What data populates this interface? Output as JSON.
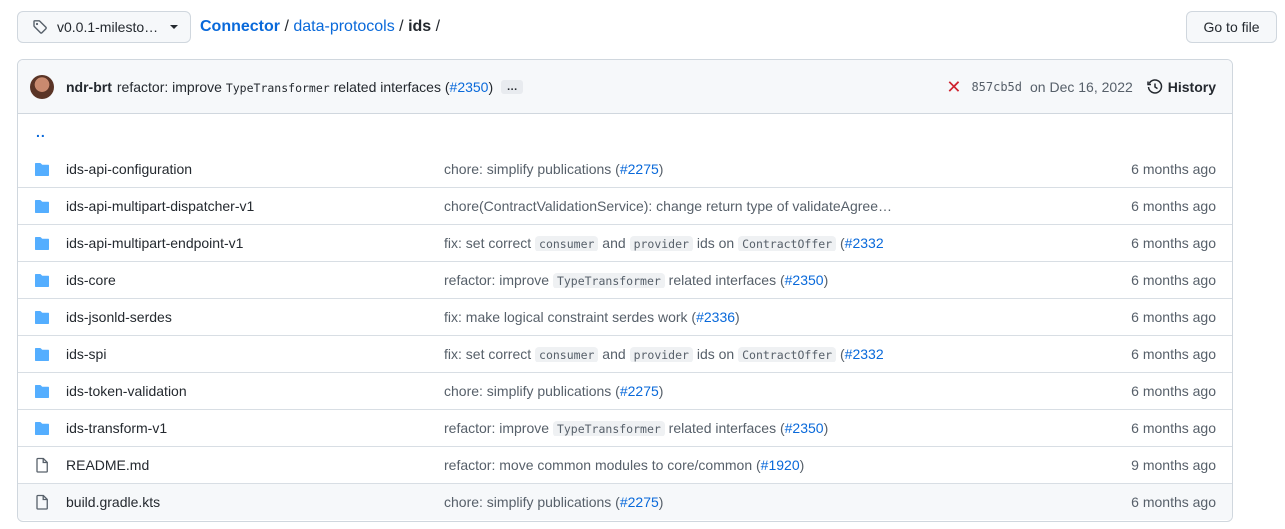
{
  "branch": {
    "label": "v0.0.1-milesto…",
    "icon": "tag-icon"
  },
  "breadcrumb": {
    "root": "Connector",
    "segment1": "data-protocols",
    "current": "ids",
    "sep": " / ",
    "trail": " /"
  },
  "go_to_file": "Go to file",
  "commit": {
    "author": "ndr-brt",
    "message_pre": "refactor: improve ",
    "message_code": "TypeTransformer",
    "message_post": " related interfaces (",
    "pr": "#2350",
    "message_end": ")",
    "more": "…",
    "status": "✕",
    "sha": "857cb5d",
    "date": "on Dec 16, 2022",
    "history": "History"
  },
  "parent_link": "..",
  "files": [
    {
      "type": "dir",
      "name": "ids-api-configuration",
      "age": "6 months ago",
      "msg": [
        {
          "t": "text",
          "v": "chore: simplify publications ("
        },
        {
          "t": "pr",
          "v": "#2275"
        },
        {
          "t": "text",
          "v": ")"
        }
      ]
    },
    {
      "type": "dir",
      "name": "ids-api-multipart-dispatcher-v1",
      "age": "6 months ago",
      "msg": [
        {
          "t": "text",
          "v": "chore(ContractValidationService): change return type of validateAgree…"
        }
      ]
    },
    {
      "type": "dir",
      "name": "ids-api-multipart-endpoint-v1",
      "age": "6 months ago",
      "msg": [
        {
          "t": "text",
          "v": "fix: set correct "
        },
        {
          "t": "code",
          "v": "consumer"
        },
        {
          "t": "text",
          "v": " and "
        },
        {
          "t": "code",
          "v": "provider"
        },
        {
          "t": "text",
          "v": " ids on "
        },
        {
          "t": "code",
          "v": "ContractOffer"
        },
        {
          "t": "text",
          "v": " ("
        },
        {
          "t": "pr",
          "v": "#2332"
        }
      ]
    },
    {
      "type": "dir",
      "name": "ids-core",
      "age": "6 months ago",
      "msg": [
        {
          "t": "text",
          "v": "refactor: improve "
        },
        {
          "t": "code",
          "v": "TypeTransformer"
        },
        {
          "t": "text",
          "v": " related interfaces ("
        },
        {
          "t": "pr",
          "v": "#2350"
        },
        {
          "t": "text",
          "v": ")"
        }
      ]
    },
    {
      "type": "dir",
      "name": "ids-jsonld-serdes",
      "age": "6 months ago",
      "msg": [
        {
          "t": "text",
          "v": "fix: make logical constraint serdes work ("
        },
        {
          "t": "pr",
          "v": "#2336"
        },
        {
          "t": "text",
          "v": ")"
        }
      ]
    },
    {
      "type": "dir",
      "name": "ids-spi",
      "age": "6 months ago",
      "msg": [
        {
          "t": "text",
          "v": "fix: set correct "
        },
        {
          "t": "code",
          "v": "consumer"
        },
        {
          "t": "text",
          "v": " and "
        },
        {
          "t": "code",
          "v": "provider"
        },
        {
          "t": "text",
          "v": " ids on "
        },
        {
          "t": "code",
          "v": "ContractOffer"
        },
        {
          "t": "text",
          "v": " ("
        },
        {
          "t": "pr",
          "v": "#2332"
        }
      ]
    },
    {
      "type": "dir",
      "name": "ids-token-validation",
      "age": "6 months ago",
      "msg": [
        {
          "t": "text",
          "v": "chore: simplify publications ("
        },
        {
          "t": "pr",
          "v": "#2275"
        },
        {
          "t": "text",
          "v": ")"
        }
      ]
    },
    {
      "type": "dir",
      "name": "ids-transform-v1",
      "age": "6 months ago",
      "msg": [
        {
          "t": "text",
          "v": "refactor: improve "
        },
        {
          "t": "code",
          "v": "TypeTransformer"
        },
        {
          "t": "text",
          "v": " related interfaces ("
        },
        {
          "t": "pr",
          "v": "#2350"
        },
        {
          "t": "text",
          "v": ")"
        }
      ]
    },
    {
      "type": "file",
      "name": "README.md",
      "age": "9 months ago",
      "msg": [
        {
          "t": "text",
          "v": "refactor: move common modules to core/common ("
        },
        {
          "t": "pr",
          "v": "#1920"
        },
        {
          "t": "text",
          "v": ")"
        }
      ]
    },
    {
      "type": "file",
      "name": "build.gradle.kts",
      "age": "6 months ago",
      "highlight": true,
      "msg": [
        {
          "t": "text",
          "v": "chore: simplify publications ("
        },
        {
          "t": "pr",
          "v": "#2275"
        },
        {
          "t": "text",
          "v": ")"
        }
      ]
    }
  ],
  "colors": {
    "folder": "#54aeff",
    "file": "#57606a",
    "link": "#0969da",
    "fail": "#cf222e"
  }
}
